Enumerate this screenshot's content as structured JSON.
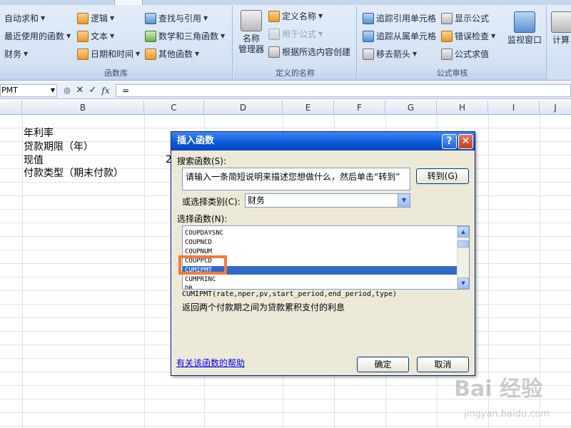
{
  "ribbon": {
    "groups": {
      "function_library": "函数库",
      "defined_names": "定义的名称",
      "formula_auditing": "公式审核"
    },
    "function_library": {
      "autosum": "自动求和",
      "recent": "最近使用的函数",
      "financial": "财务",
      "logical": "逻辑",
      "text": "文本",
      "datetime": "日期和时间",
      "lookup": "查找与引用",
      "math": "数学和三角函数",
      "other": "其他函数"
    },
    "defined_names": {
      "name_manager_line1": "名称",
      "name_manager_line2": "管理器",
      "define_name": "定义名称",
      "use_in_formula": "用于公式",
      "create_from_selection": "根据所选内容创建"
    },
    "auditing": {
      "trace_precedents": "追踪引用单元格",
      "trace_dependents": "追踪从属单元格",
      "remove_arrows": "移去箭头",
      "show_formulas": "显示公式",
      "error_checking": "错误检查",
      "evaluate_formula": "公式求值",
      "watch_window": "监视窗口",
      "calculation": "计算"
    }
  },
  "formula_bar": {
    "name_box": "PMT",
    "formula": "="
  },
  "columns": [
    "B",
    "C",
    "D",
    "E",
    "F",
    "G",
    "H",
    "I",
    "J"
  ],
  "cells": {
    "row1": "年利率",
    "row2": "贷款期限（年）",
    "row3": "现值",
    "row4": "付款类型（期末付款）",
    "c3_partial": "2"
  },
  "dialog": {
    "title": "插入函数",
    "search_label": "搜索函数(S):",
    "search_value": "请输入一条简短说明来描述您想做什么，然后单击“转到”",
    "go_button": "转到(G)",
    "category_label": "或选择类别(C):",
    "category_value": "财务",
    "select_label": "选择函数(N):",
    "functions": [
      "COUPDAYSNC",
      "COUPNCD",
      "COUPNUM",
      "COUPPCD",
      "CUMIPMT",
      "CUMPRINC",
      "DB"
    ],
    "selected_function": "CUMIPMT",
    "signature": "CUMIPMT(rate,nper,pv,start_period,end_period,type)",
    "description": "返回两个付款期之间为贷款累积支付的利息",
    "help_link": "有关该函数的帮助",
    "ok_button": "确定",
    "cancel_button": "取消"
  },
  "watermark": {
    "main": "Bai 经验",
    "sub": "jingyan.baidu.com"
  }
}
